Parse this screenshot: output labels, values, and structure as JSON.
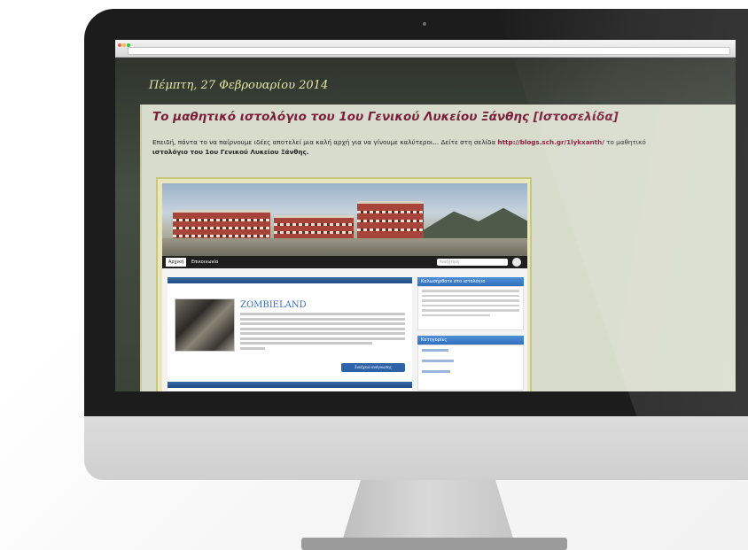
{
  "browser": {
    "window_dots": [
      "#ff5f57",
      "#febc2e",
      "#28c840"
    ]
  },
  "blog": {
    "date_header": "Πέμπτη, 27 Φεβρουαρίου 2014",
    "post_title": "Το μαθητικό ιστολόγιο του 1ου Γενικού Λυκείου Ξάνθης [Ιστοσελίδα]",
    "post_text_before_link": "Επειδή, πάντα το να παίρνουμε ιδέες αποτελεί μια καλή αρχή για να γίνουμε καλύτεροι... Δείτε στη σελίδα",
    "post_link": "http://blogs.sch.gr/1lykxanth/",
    "post_text_after_link": "το μαθητικό",
    "post_text_bold": "ιστολόγιο του 1ου Γενικού Λυκείου Ξάνθης."
  },
  "embedded_site": {
    "nav_tabs": [
      "Αρχική",
      "Επικοινωνία"
    ],
    "search_placeholder": "Αναζήτηση",
    "movie_title": "ZOMBIELAND",
    "more_button": "Συνέχεια ανάγνωσης",
    "sidebar_heading_1": "Καλωσήρθατε στο ιστολόγιο",
    "sidebar_heading_2": "Κατηγορίες"
  },
  "colors": {
    "title": "#7a1f3b",
    "date": "#e8e5a6",
    "link": "#8b1a3a",
    "post_bg": "#d8dccd"
  }
}
